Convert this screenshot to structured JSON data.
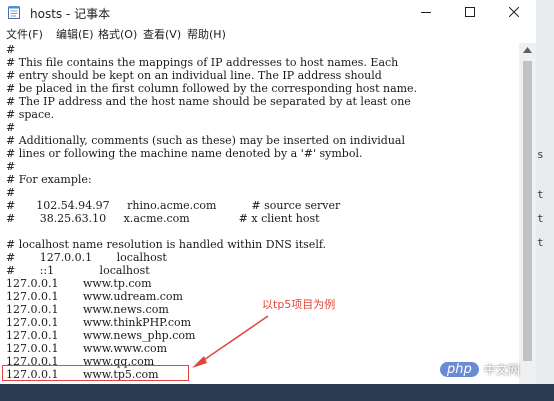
{
  "window": {
    "title": "hosts - 记事本",
    "controls": {
      "minimize": "minimize",
      "maximize": "maximize",
      "close": "close"
    }
  },
  "menu": [
    {
      "label": "文件(F)"
    },
    {
      "label": "编辑(E)"
    },
    {
      "label": "格式(O)"
    },
    {
      "label": "查看(V)"
    },
    {
      "label": "帮助(H)"
    }
  ],
  "editor": {
    "lines": [
      "#",
      "# This file contains the mappings of IP addresses to host names. Each",
      "# entry should be kept on an individual line. The IP address should",
      "# be placed in the first column followed by the corresponding host name.",
      "# The IP address and the host name should be separated by at least one",
      "# space.",
      "#",
      "# Additionally, comments (such as these) may be inserted on individual",
      "# lines or following the machine name denoted by a '#' symbol.",
      "#",
      "# For example:",
      "#",
      "#      102.54.94.97     rhino.acme.com          # source server",
      "#       38.25.63.10     x.acme.com              # x client host",
      "",
      "# localhost name resolution is handled within DNS itself.",
      "#       127.0.0.1       localhost",
      "#       ::1             localhost",
      "127.0.0.1       www.tp.com",
      "127.0.0.1       www.udream.com",
      "127.0.0.1       www.news.com",
      "127.0.0.1       www.thinkPHP.com",
      "127.0.0.1       www.news_php.com",
      "127.0.0.1       www.www.com",
      "127.0.0.1       www.qq.com",
      "127.0.0.1       www.tp5.com"
    ]
  },
  "annotation": {
    "text": "以tp5项目为例",
    "color": "#e0473c"
  },
  "watermark": {
    "badge": "php",
    "site": "中文网"
  },
  "desktop_strip": [
    "s",
    "t",
    "t",
    "t"
  ]
}
